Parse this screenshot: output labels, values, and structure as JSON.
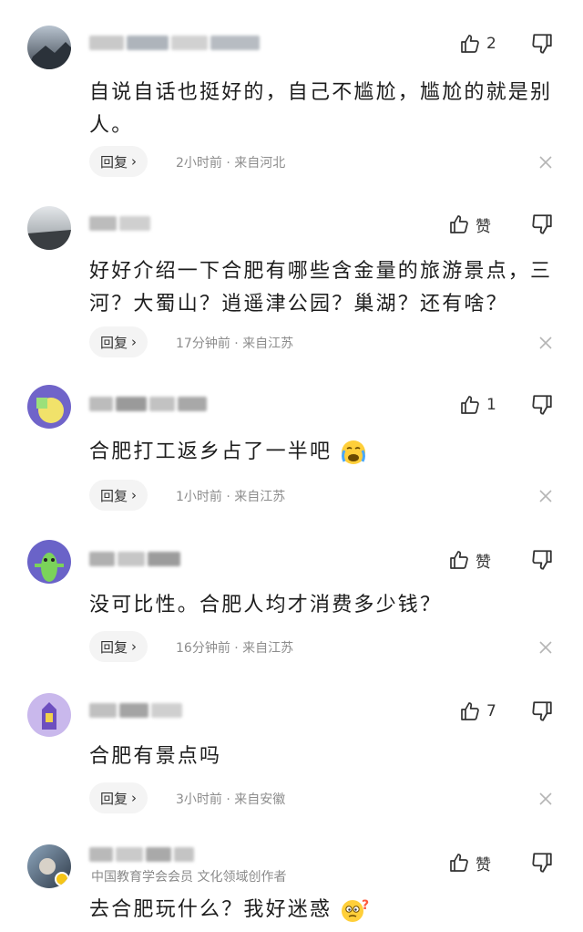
{
  "comments": [
    {
      "text": "自说自话也挺好的，自己不尴尬，尴尬的就是别人。",
      "like_label": "2",
      "reply_label": "回复",
      "meta": "2小时前 · 来自河北",
      "subtitle": ""
    },
    {
      "text": "好好介绍一下合肥有哪些含金量的旅游景点，三河？大蜀山？逍遥津公园？巢湖？还有啥？",
      "like_label": "赞",
      "reply_label": "回复",
      "meta": "17分钟前 · 来自江苏",
      "subtitle": ""
    },
    {
      "text": "合肥打工返乡占了一半吧",
      "like_label": "1",
      "reply_label": "回复",
      "meta": "1小时前 · 来自江苏",
      "subtitle": ""
    },
    {
      "text": "没可比性。合肥人均才消费多少钱？",
      "like_label": "赞",
      "reply_label": "回复",
      "meta": "16分钟前 · 来自江苏",
      "subtitle": ""
    },
    {
      "text": "合肥有景点吗",
      "like_label": "7",
      "reply_label": "回复",
      "meta": "3小时前 · 来自安徽",
      "subtitle": ""
    },
    {
      "text": "去合肥玩什么？我好迷惑",
      "like_label": "赞",
      "reply_label": "",
      "meta": "",
      "subtitle": "中国教育学会会员 文化领域创作者"
    }
  ],
  "icons": {
    "like": "thumbs-up-icon",
    "dislike": "thumbs-down-icon",
    "close": "close-icon",
    "chevron": "chevron-right-icon"
  },
  "colors": {
    "text": "#1d1d1d",
    "meta": "#8d8d8d",
    "reply_bg": "#f4f4f4"
  }
}
